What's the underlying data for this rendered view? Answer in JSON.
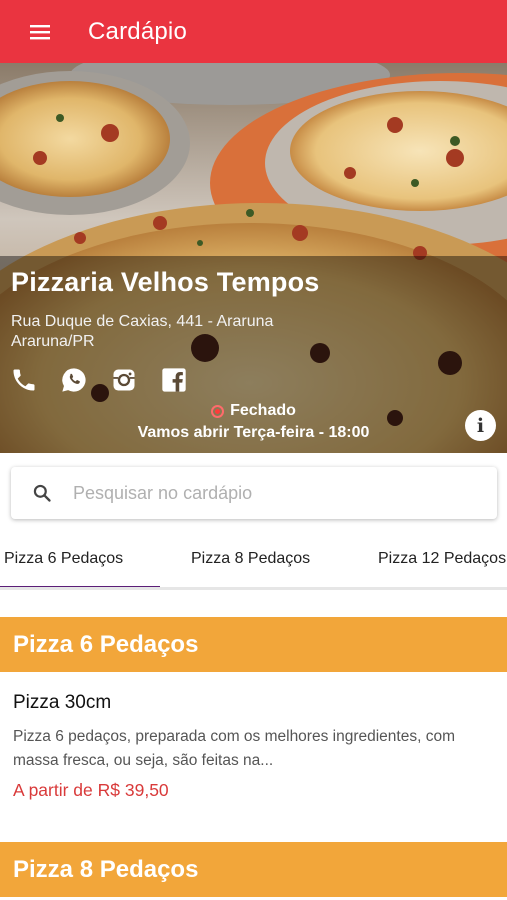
{
  "appbar": {
    "title": "Cardápio",
    "color": "#ea3440"
  },
  "restaurant": {
    "name": "Pizzaria Velhos Tempos",
    "address_line1": "Rua Duque de Caxias, 441 - Araruna",
    "address_line2": "Araruna/PR",
    "social": [
      "phone-icon",
      "whatsapp-icon",
      "instagram-icon",
      "facebook-icon"
    ],
    "status": "Fechado",
    "opening": "Vamos abrir Terça-feira - 18:00"
  },
  "search": {
    "placeholder": "Pesquisar no cardápio",
    "value": ""
  },
  "tabs": [
    {
      "label": "Pizza 6 Pedaços",
      "active": true
    },
    {
      "label": "Pizza 8 Pedaços",
      "active": false
    },
    {
      "label": "Pizza 12 Pedaços",
      "active": false
    }
  ],
  "sections": [
    {
      "title": "Pizza 6 Pedaços",
      "products": [
        {
          "name": "Pizza 30cm",
          "description": "Pizza 6 pedaços, preparada com os melhores ingredientes, com massa fresca, ou seja, são feitas na...",
          "price": "A partir de R$ 39,50"
        }
      ]
    },
    {
      "title": "Pizza 8 Pedaços",
      "products": []
    }
  ],
  "colors": {
    "accent": "#ea3440",
    "section": "#f2a63a",
    "tab_indicator": "#5b1e78",
    "price": "#d93a3a"
  }
}
